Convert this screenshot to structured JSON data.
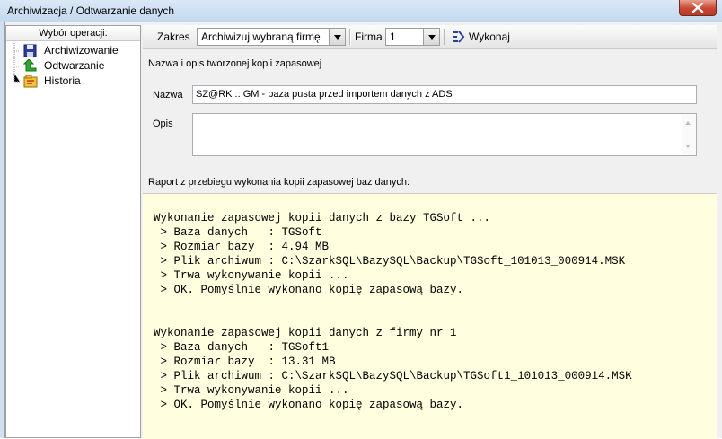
{
  "window": {
    "title": "Archiwizacja / Odtwarzanie danych"
  },
  "tree": {
    "header": "Wybór operacji:",
    "items": [
      {
        "label": "Archiwizowanie",
        "icon": "save-disk-icon"
      },
      {
        "label": "Odtwarzanie",
        "icon": "green-restore-arrow-icon"
      },
      {
        "label": "Historia",
        "icon": "history-folder-icon"
      }
    ]
  },
  "toolbar": {
    "zakres_label": "Zakres",
    "zakres_value": "Archiwizuj wybraną firmę",
    "firma_label": "Firma",
    "firma_value": "1",
    "run_label": "Wykonaj",
    "run_icon": "run-gear-icon"
  },
  "copy_section": {
    "header": "Nazwa i opis tworzonej kopii zapasowej",
    "name_label": "Nazwa",
    "name_value": "SZ@RK :: GM - baza pusta przed importem danych z ADS",
    "desc_label": "Opis",
    "desc_value": ""
  },
  "report": {
    "header": "Raport z przebiegu wykonania kopii zapasowej baz danych:",
    "lines": [
      "Wykonanie zapasowej kopii danych z bazy TGSoft ...",
      " > Baza danych   : TGSoft",
      " > Rozmiar bazy  : 4.94 MB",
      " > Plik archiwum : C:\\SzarkSQL\\BazySQL\\Backup\\TGSoft_101013_000914.MSK",
      " > Trwa wykonywanie kopii ...",
      " > OK. Pomyślnie wykonano kopię zapasową bazy.",
      "",
      "",
      "Wykonanie zapasowej kopii danych z firmy nr 1",
      " > Baza danych   : TGSoft1",
      " > Rozmiar bazy  : 13.31 MB",
      " > Plik archiwum : C:\\SzarkSQL\\BazySQL\\Backup\\TGSoft1_101013_000914.MSK",
      " > Trwa wykonywanie kopii ...",
      " > OK. Pomyślnie wykonano kopię zapasową bazy."
    ]
  },
  "colors": {
    "title_bar": "#c3d8ef",
    "close_button": "#c94632",
    "report_background": "#ffffe0"
  }
}
